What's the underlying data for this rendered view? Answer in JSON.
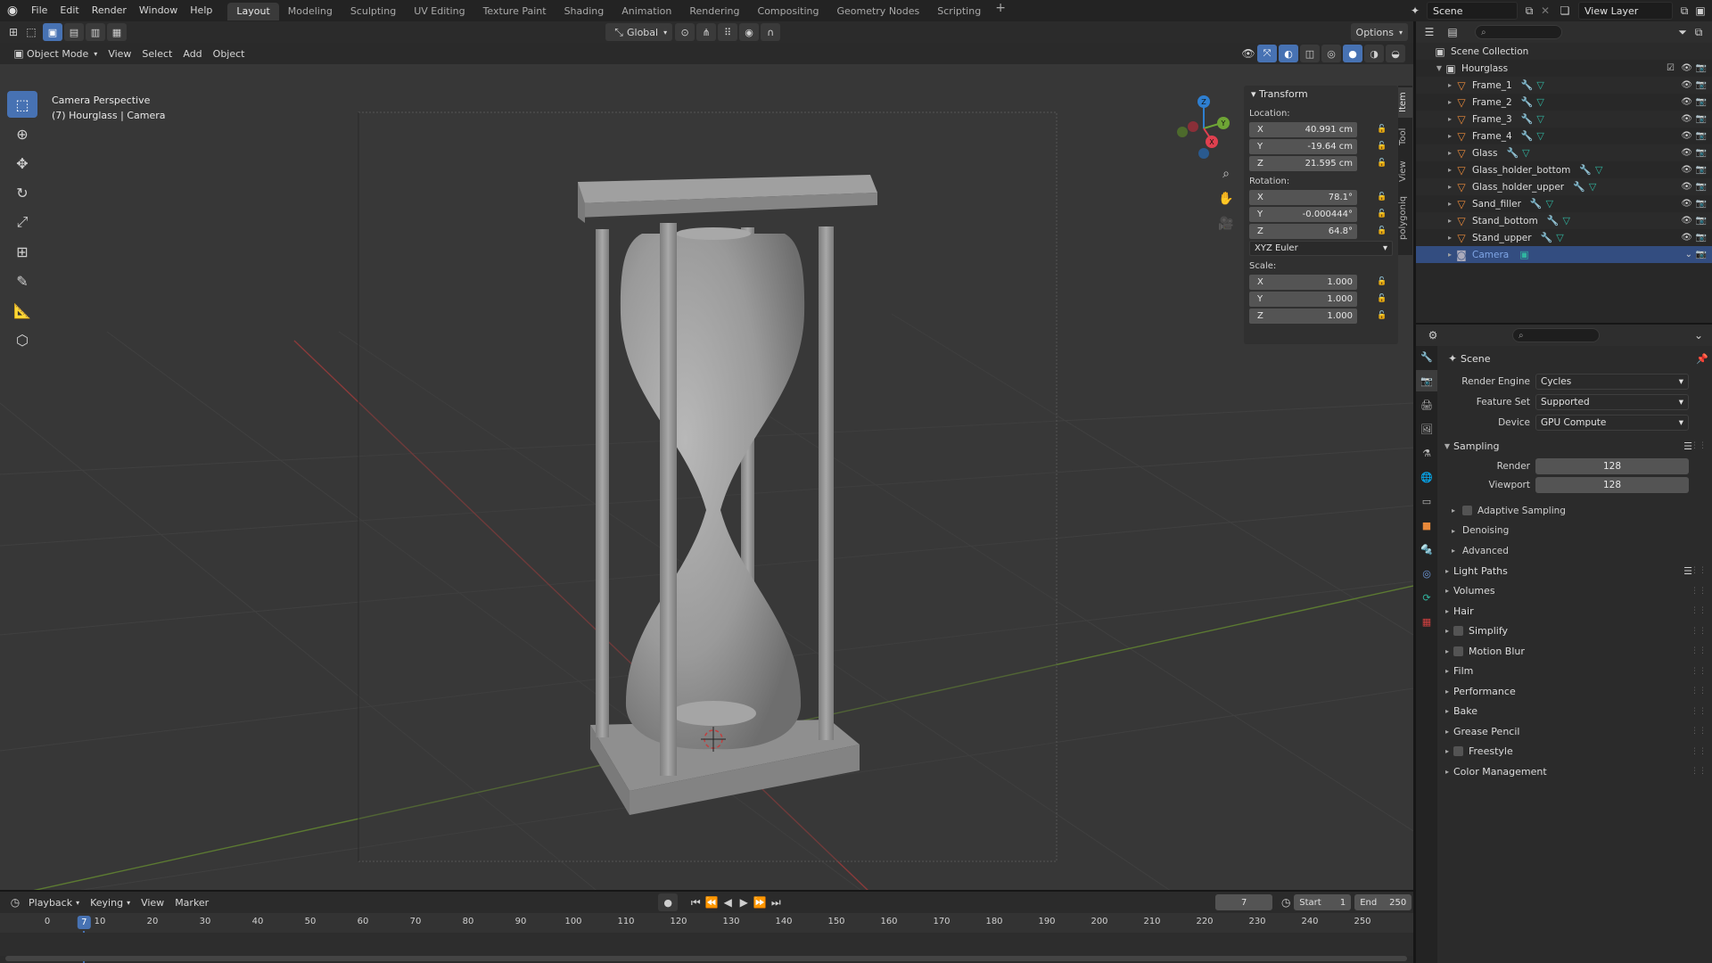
{
  "topbar": {
    "menus": [
      "File",
      "Edit",
      "Render",
      "Window",
      "Help"
    ],
    "workspaces": [
      "Layout",
      "Modeling",
      "Sculpting",
      "UV Editing",
      "Texture Paint",
      "Shading",
      "Animation",
      "Rendering",
      "Compositing",
      "Geometry Nodes",
      "Scripting"
    ],
    "active_workspace": "Layout",
    "scene_name": "Scene",
    "view_layer": "View Layer"
  },
  "viewport": {
    "mode": "Object Mode",
    "menus": [
      "View",
      "Select",
      "Add",
      "Object"
    ],
    "orientation": "Global",
    "options_label": "Options",
    "overlay_line1": "Camera Perspective",
    "overlay_line2": "(7) Hourglass | Camera",
    "gizmo_axes": {
      "x": "X",
      "y": "Y",
      "z": "Z"
    },
    "side_tabs": [
      "Item",
      "Tool",
      "View",
      "polygoniq"
    ]
  },
  "transform": {
    "title": "Transform",
    "location_label": "Location:",
    "location": [
      {
        "axis": "X",
        "value": "40.991 cm"
      },
      {
        "axis": "Y",
        "value": "-19.64 cm"
      },
      {
        "axis": "Z",
        "value": "21.595 cm"
      }
    ],
    "rotation_label": "Rotation:",
    "rotation": [
      {
        "axis": "X",
        "value": "78.1°"
      },
      {
        "axis": "Y",
        "value": "-0.000444°"
      },
      {
        "axis": "Z",
        "value": "64.8°"
      }
    ],
    "rotation_mode": "XYZ Euler",
    "scale_label": "Scale:",
    "scale": [
      {
        "axis": "X",
        "value": "1.000"
      },
      {
        "axis": "Y",
        "value": "1.000"
      },
      {
        "axis": "Z",
        "value": "1.000"
      }
    ]
  },
  "timeline": {
    "menus": [
      "Playback",
      "Keying",
      "View",
      "Marker"
    ],
    "current_frame": "7",
    "start_label": "Start",
    "start": "1",
    "end_label": "End",
    "end": "250",
    "ticks": [
      "0",
      "10",
      "20",
      "30",
      "40",
      "50",
      "60",
      "70",
      "80",
      "90",
      "100",
      "110",
      "120",
      "130",
      "140",
      "150",
      "160",
      "170",
      "180",
      "190",
      "200",
      "210",
      "220",
      "230",
      "240",
      "250"
    ]
  },
  "outliner": {
    "root": "Scene Collection",
    "collection": "Hourglass",
    "objects": [
      "Frame_1",
      "Frame_2",
      "Frame_3",
      "Frame_4",
      "Glass",
      "Glass_holder_bottom",
      "Glass_holder_upper",
      "Sand_filler",
      "Stand_bottom",
      "Stand_upper"
    ],
    "camera": "Camera"
  },
  "properties": {
    "context": "Scene",
    "render_engine_label": "Render Engine",
    "render_engine": "Cycles",
    "feature_set_label": "Feature Set",
    "feature_set": "Supported",
    "device_label": "Device",
    "device": "GPU Compute",
    "sampling": "Sampling",
    "render_label": "Render",
    "render_samples": "128",
    "viewport_label": "Viewport",
    "viewport_samples": "128",
    "sub_sections": [
      "Adaptive Sampling",
      "Denoising",
      "Advanced"
    ],
    "sections": [
      "Light Paths",
      "Volumes",
      "Hair",
      "Simplify",
      "Motion Blur",
      "Film",
      "Performance",
      "Bake",
      "Grease Pencil",
      "Freestyle",
      "Color Management"
    ]
  },
  "colors": {
    "accent": "#4772b3",
    "object_icon": "#e8893a",
    "mesh_icon": "#30b5a0",
    "x_axis": "#e0404f",
    "y_axis": "#6ea535",
    "z_axis": "#2e7fd1"
  }
}
